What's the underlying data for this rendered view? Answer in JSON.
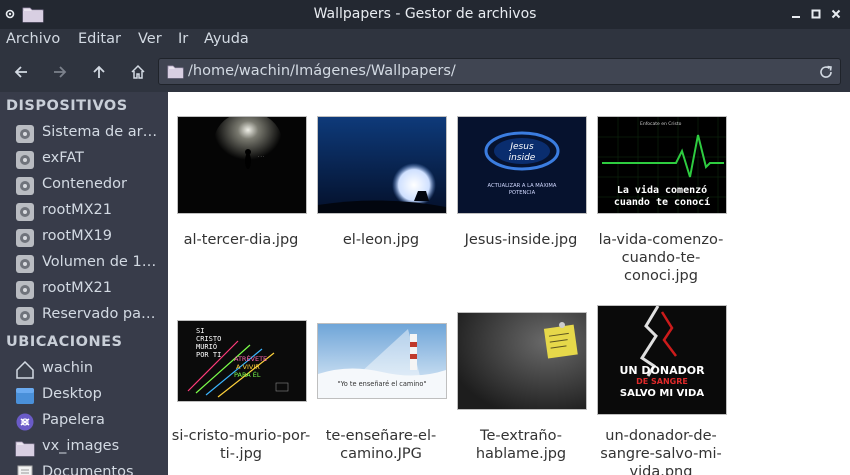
{
  "window": {
    "title": "Wallpapers - Gestor de archivos"
  },
  "menu": {
    "items": [
      "Archivo",
      "Editar",
      "Ver",
      "Ir",
      "Ayuda"
    ]
  },
  "toolbar": {
    "path": "/home/wachin/Imágenes/Wallpapers/"
  },
  "sidebar": {
    "devices_header": "DISPOSITIVOS",
    "devices": [
      {
        "label": "Sistema de ar…",
        "icon": "drive-icon"
      },
      {
        "label": "exFAT",
        "icon": "drive-icon"
      },
      {
        "label": "Contenedor",
        "icon": "drive-icon"
      },
      {
        "label": "rootMX21",
        "icon": "drive-icon"
      },
      {
        "label": "rootMX19",
        "icon": "drive-icon"
      },
      {
        "label": "Volumen de 1…",
        "icon": "drive-icon"
      },
      {
        "label": "rootMX21",
        "icon": "drive-icon"
      },
      {
        "label": "Reservado pa…",
        "icon": "drive-icon"
      }
    ],
    "places_header": "UBICACIONES",
    "places": [
      {
        "label": "wachin",
        "icon": "home-icon"
      },
      {
        "label": "Desktop",
        "icon": "desktop-icon"
      },
      {
        "label": "Papelera",
        "icon": "trash-icon"
      },
      {
        "label": "vx_images",
        "icon": "folder-icon"
      },
      {
        "label": "Documentos",
        "icon": "document-icon"
      }
    ]
  },
  "files": [
    {
      "name": "al-tercer-dia.jpg"
    },
    {
      "name": "el-leon.jpg"
    },
    {
      "name": "Jesus-inside.jpg",
      "thumb_text": [
        "Jesus",
        "inside",
        "ACTUALIZAR A LA MÁXIMA",
        "POTENCIA"
      ]
    },
    {
      "name": "la-vida-comenzo-cuando-te-conoci.jpg",
      "thumb_text": [
        "Enfocate en Cristo",
        "La vida comenzó",
        "cuando te conocí"
      ]
    },
    {
      "name": "si-cristo-murio-por-ti-.jpg",
      "thumb_text": [
        "SI",
        "CRISTO",
        "MURIÓ",
        "POR TI",
        "ATRÉVETE",
        "A VIVIR",
        "PARA ÉL"
      ]
    },
    {
      "name": "te-enseñare-el-camino.JPG",
      "thumb_text": [
        "\"Yo te enseñaré el camino\""
      ]
    },
    {
      "name": "Te-extraño-hablame.jpg"
    },
    {
      "name": "un-donador-de-sangre-salvo-mi-vida.png",
      "thumb_text": [
        "UN DONADOR",
        "DE SANGRE",
        "SALVO MI VIDA"
      ]
    }
  ],
  "colors": {
    "titlebar": "#232831",
    "toolbar": "#2f343f",
    "sidebar": "#383c4a",
    "accent_green": "#2ecc40",
    "accent_red": "#cc1b1b"
  }
}
